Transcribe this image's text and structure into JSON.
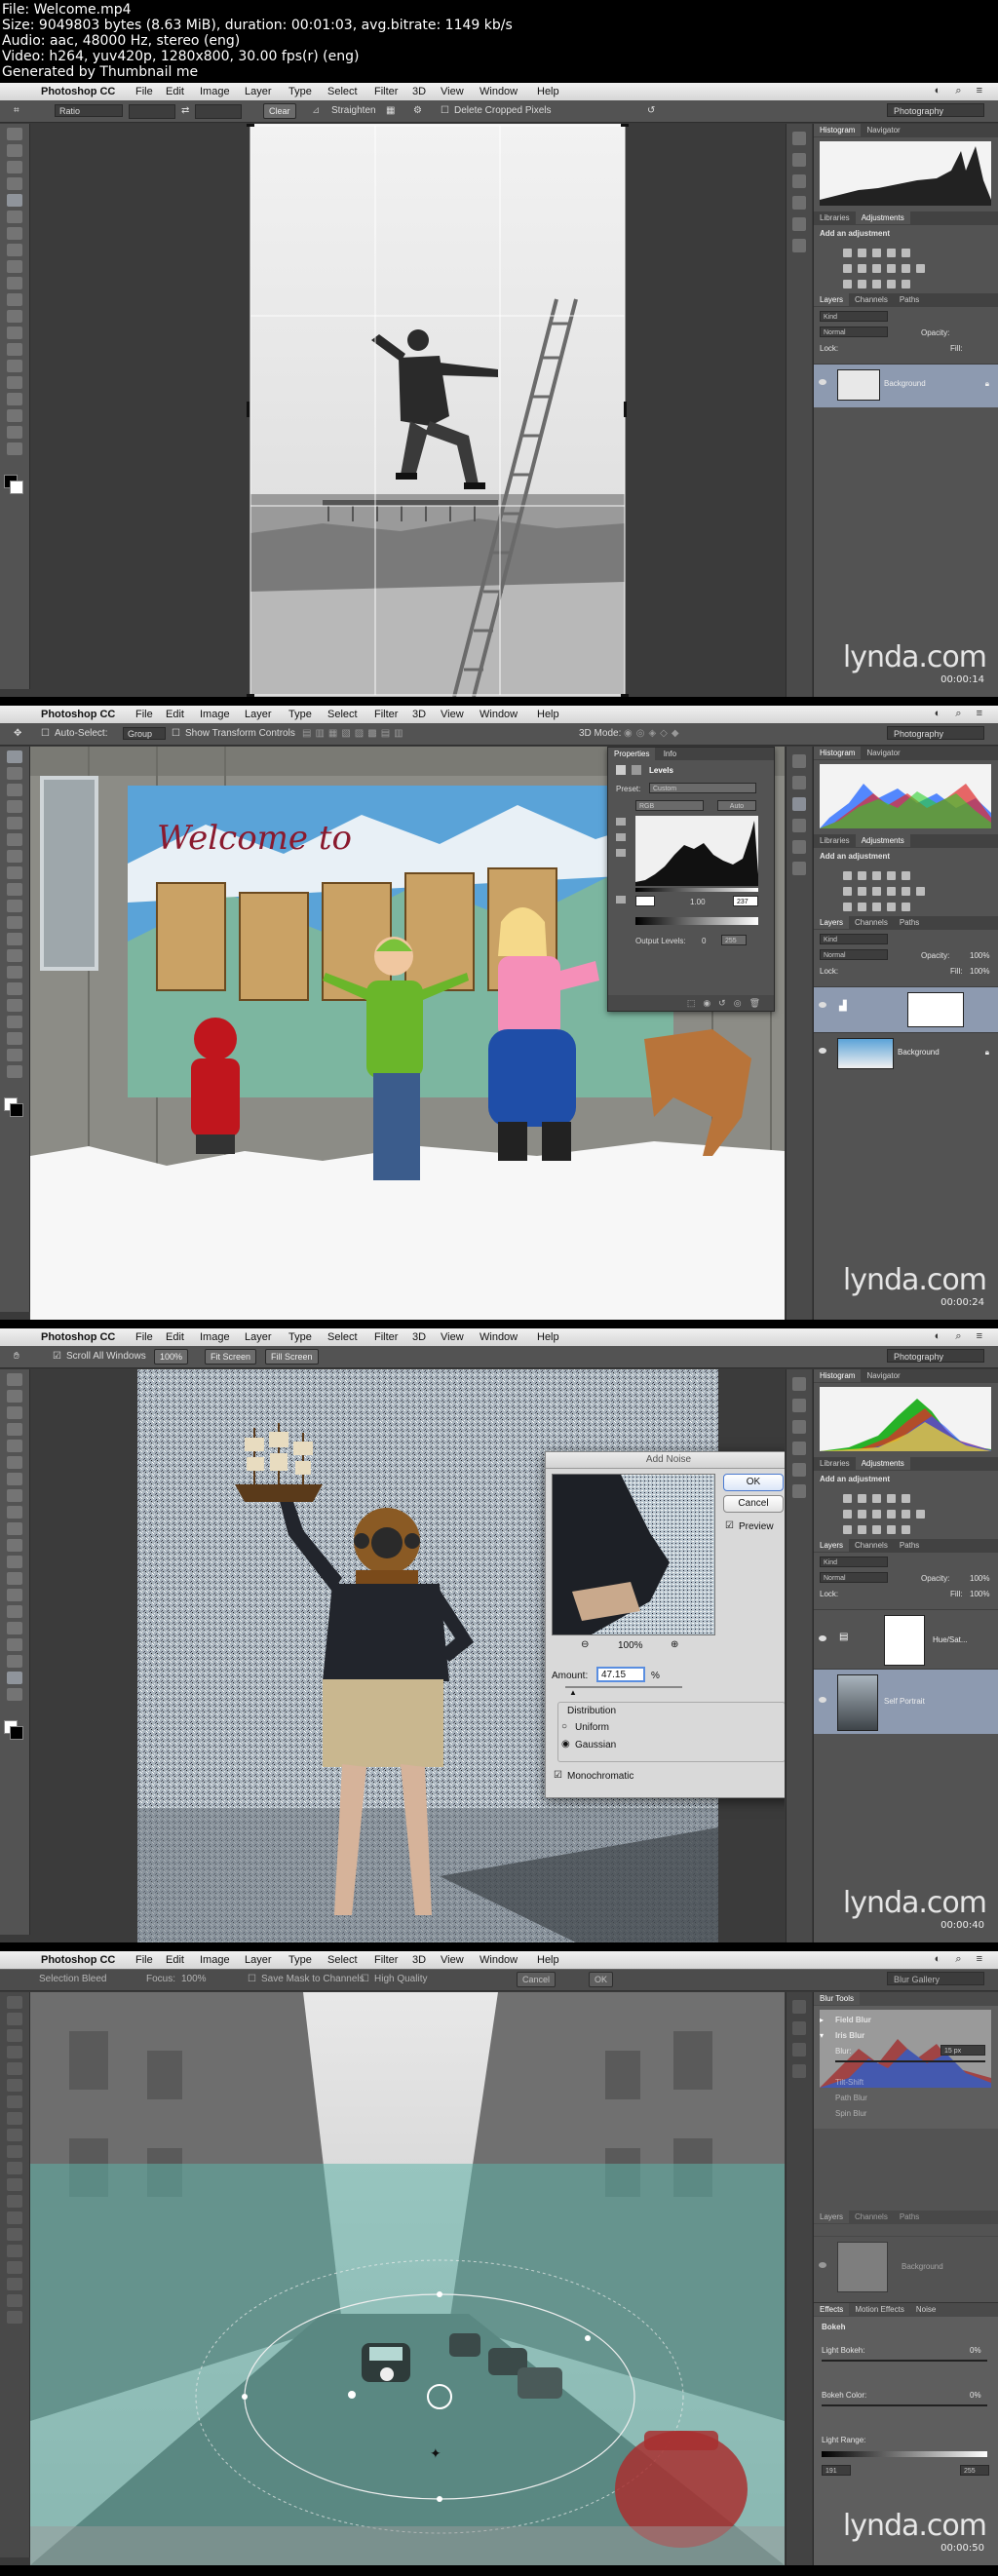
{
  "header": {
    "lines": [
      "File: Welcome.mp4",
      "Size: 9049803 bytes (8.63 MiB), duration: 00:01:03, avg.bitrate: 1149 kb/s",
      "Audio: aac, 48000 Hz, stereo (eng)",
      "Video: h264, yuv420p, 1280x800, 30.00 fps(r) (eng)",
      "Generated by Thumbnail me"
    ]
  },
  "menu": {
    "app": "Photoshop CC",
    "items": [
      "File",
      "Edit",
      "Image",
      "Layer",
      "Type",
      "Select",
      "Filter",
      "3D",
      "View",
      "Window",
      "Help"
    ]
  },
  "watermark": "lynda.com",
  "colors": {
    "menubar": "#e3e3e3",
    "panel": "#535353",
    "canvas": "#3b3b3b",
    "selected_layer": "#8d9ab0",
    "dialog": "#d9d9d9"
  },
  "frames": [
    {
      "timestamp": "00:00:14",
      "workspace": "Photography",
      "options": {
        "ratio": "Ratio",
        "clear": "Clear",
        "straighten": "Straighten",
        "delete_cropped": "Delete Cropped Pixels"
      },
      "panels": {
        "histogram_tabs": [
          "Histogram",
          "Navigator"
        ],
        "adjust_tabs": [
          "Libraries",
          "Adjustments"
        ],
        "add_adjustment": "Add an adjustment",
        "layers_tabs": [
          "Layers",
          "Channels",
          "Paths"
        ],
        "kind": "Kind",
        "blend": "Normal",
        "opacity_label": "Opacity:",
        "lock_label": "Lock:",
        "fill_label": "Fill:",
        "layers": [
          {
            "name": "Background"
          }
        ]
      }
    },
    {
      "timestamp": "00:00:24",
      "workspace": "Photography",
      "options": {
        "auto_select": "Auto-Select:",
        "group": "Group",
        "show_transform": "Show Transform Controls",
        "mode_3d": "3D Mode:"
      },
      "properties": {
        "tabs": [
          "Properties",
          "Info"
        ],
        "title": "Levels",
        "preset_label": "Preset:",
        "preset": "Custom",
        "channel": "RGB",
        "auto": "Auto",
        "input_values": [
          "1.00",
          "237"
        ],
        "output_label": "Output Levels:",
        "output_values": [
          "0",
          "255"
        ]
      },
      "panels": {
        "histogram_tabs": [
          "Histogram",
          "Navigator"
        ],
        "adjust_tabs": [
          "Libraries",
          "Adjustments"
        ],
        "add_adjustment": "Add an adjustment",
        "layers_tabs": [
          "Layers",
          "Channels",
          "Paths"
        ],
        "kind": "Kind",
        "blend": "Normal",
        "opacity_label": "Opacity:",
        "opacity": "100%",
        "lock_label": "Lock:",
        "fill_label": "Fill:",
        "fill": "100%",
        "layers": [
          {
            "name": ""
          },
          {
            "name": "Background"
          }
        ]
      }
    },
    {
      "timestamp": "00:00:40",
      "workspace": "Photography",
      "options": {
        "scroll_all": "Scroll All Windows",
        "zoom": "100%",
        "fit_screen": "Fit Screen",
        "fill_screen": "Fill Screen"
      },
      "add_noise": {
        "title": "Add Noise",
        "ok": "OK",
        "cancel": "Cancel",
        "preview": "Preview",
        "zoom": "100%",
        "amount_label": "Amount:",
        "amount": "47.15",
        "amount_unit": "%",
        "distribution_label": "Distribution",
        "uniform": "Uniform",
        "gaussian": "Gaussian",
        "monochromatic": "Monochromatic"
      },
      "panels": {
        "histogram_tabs": [
          "Histogram",
          "Navigator"
        ],
        "adjust_tabs": [
          "Libraries",
          "Adjustments"
        ],
        "add_adjustment": "Add an adjustment",
        "layers_tabs": [
          "Layers",
          "Channels",
          "Paths"
        ],
        "kind": "Kind",
        "blend": "Normal",
        "opacity_label": "Opacity:",
        "opacity": "100%",
        "lock_label": "Lock:",
        "fill_label": "Fill:",
        "fill": "100%",
        "layers": [
          {
            "name": "Hue/Sat..."
          },
          {
            "name": "Self Portrait"
          }
        ]
      }
    },
    {
      "timestamp": "00:00:50",
      "workspace": "Blur Gallery",
      "options": {
        "selection_bleed": "Selection Bleed",
        "focus": "Focus:",
        "focus_value": "100%",
        "save_mask": "Save Mask to Channels",
        "high_quality": "High Quality",
        "cancel": "Cancel",
        "ok": "OK"
      },
      "blur_tools": {
        "title": "Blur Tools",
        "field_blur": "Field Blur",
        "iris_blur": "Iris Blur",
        "blur_label": "Blur:",
        "blur_value": "15 px",
        "tilt_shift": "Tilt-Shift",
        "path_blur": "Path Blur",
        "spin_blur": "Spin Blur"
      },
      "effects": {
        "tabs": [
          "Effects",
          "Motion Effects",
          "Noise"
        ],
        "bokeh": "Bokeh",
        "light_bokeh": "Light Bokeh:",
        "light_bokeh_value": "0%",
        "bokeh_color": "Bokeh Color:",
        "bokeh_color_value": "0%",
        "light_range": "Light Range:",
        "range_values": [
          "191",
          "255"
        ]
      },
      "panels": {
        "layers_tabs": [
          "Layers",
          "Channels",
          "Paths"
        ],
        "layers": [
          {
            "name": "Background"
          }
        ]
      }
    }
  ]
}
